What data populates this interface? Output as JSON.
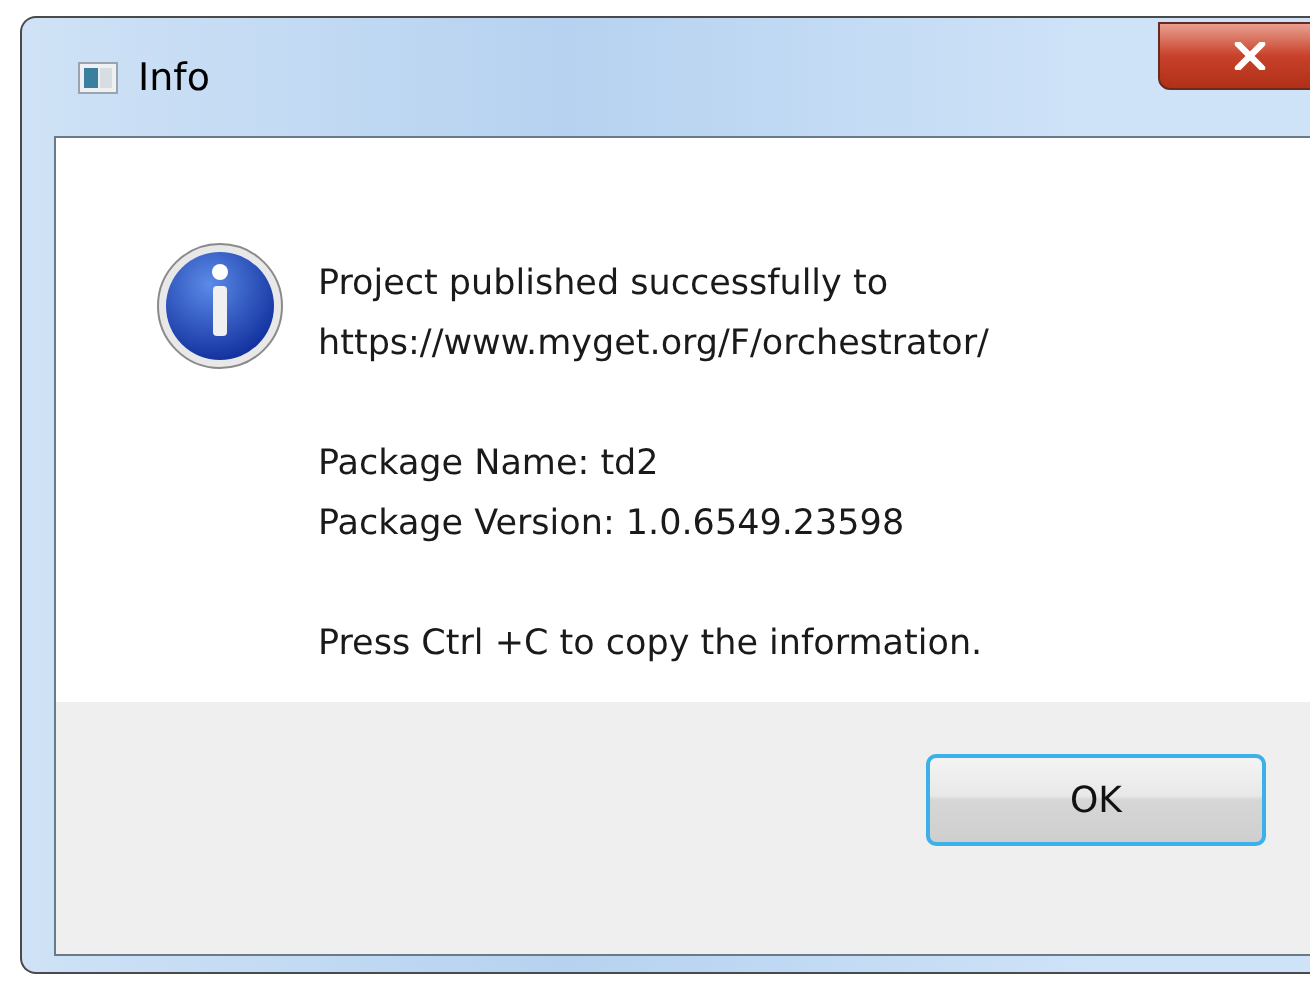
{
  "window": {
    "title": "Info"
  },
  "message": {
    "paragraphs": [
      [
        "Project published successfully to",
        "https://www.myget.org/F/orchestrator/"
      ],
      [
        "Package Name: td2",
        "Package Version: 1.0.6549.23598"
      ],
      [
        "Press Ctrl +C to copy the information."
      ]
    ]
  },
  "buttons": [
    "OK"
  ]
}
